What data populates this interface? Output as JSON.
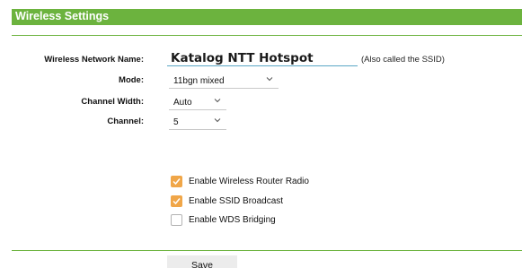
{
  "header": {
    "title": "Wireless Settings"
  },
  "form": {
    "ssid": {
      "label": "Wireless Network Name:",
      "value": "Katalog NTT Hotspot",
      "note": "(Also called the SSID)"
    },
    "mode": {
      "label": "Mode:",
      "value": "11bgn mixed"
    },
    "channel_width": {
      "label": "Channel Width:",
      "value": "Auto"
    },
    "channel": {
      "label": "Channel:",
      "value": "5"
    }
  },
  "options": [
    {
      "label": "Enable Wireless Router Radio",
      "checked": true
    },
    {
      "label": "Enable SSID Broadcast",
      "checked": true
    },
    {
      "label": "Enable WDS Bridging",
      "checked": false
    }
  ],
  "actions": {
    "save_label": "Save"
  },
  "colors": {
    "accent": "#6cb33e",
    "checkbox_on": "#f0a648",
    "input_underline": "#5aa6c6"
  }
}
